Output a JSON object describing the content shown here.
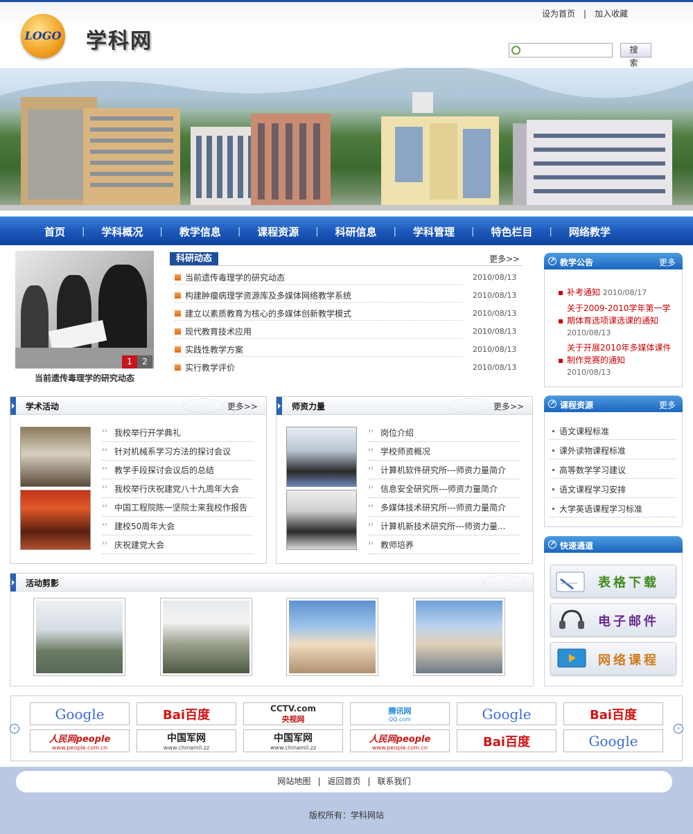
{
  "header": {
    "logo_text": "LOGO",
    "site_title": "学科网",
    "links": [
      "设为首页",
      "加入收藏"
    ],
    "link_sep": "|",
    "search_placeholder": "",
    "search_button": "搜 索"
  },
  "nav": {
    "items": [
      "首页",
      "学科概况",
      "教学信息",
      "课程资源",
      "科研信息",
      "学科管理",
      "特色栏目",
      "网络教学"
    ],
    "sep": "|"
  },
  "slideshow": {
    "caption": "当前遗传毒理学的研究动态",
    "pages": [
      "1",
      "2"
    ]
  },
  "research": {
    "title": "科研动态",
    "more": "更多>>",
    "items": [
      {
        "title": "当前遗传毒理学的研究动态",
        "date": "2010/08/13"
      },
      {
        "title": "构建肿瘤病理学资源库及多媒体网络教学系统",
        "date": "2010/08/13"
      },
      {
        "title": "建立以素质教育为核心的多媒体创新教学模式",
        "date": "2010/08/13"
      },
      {
        "title": "现代教育技术应用",
        "date": "2010/08/13"
      },
      {
        "title": "实践性教学方案",
        "date": "2010/08/13"
      },
      {
        "title": "实行教学评价",
        "date": "2010/08/13"
      }
    ]
  },
  "notice": {
    "title": "教学公告",
    "more": "更多",
    "items": [
      {
        "lines": [
          "补考通知"
        ],
        "date": "2010/08/17"
      },
      {
        "lines": [
          "关于2009-2010学年第一学",
          "期体育选项课选课的通知"
        ],
        "date": "2010/08/13"
      },
      {
        "lines": [
          "关于开展2010年多媒体课件",
          "制作竞赛的通知"
        ],
        "date": "2010/08/13"
      }
    ]
  },
  "academic": {
    "title": "学术活动",
    "more": "更多>>",
    "items": [
      "我校举行开学典礼",
      "针对机械系学习方法的探讨会议",
      "教学手段探讨会议后的总结",
      "我校举行庆祝建党八十九周年大会",
      "中国工程院陈一坚院士来我校作报告",
      "建校50周年大会",
      "庆祝建党大会"
    ]
  },
  "faculty": {
    "title": "师资力量",
    "more": "更多>>",
    "items": [
      "岗位介绍",
      "学校师资概况",
      "计算机软件研究所---师资力量简介",
      "信息安全研究所---师资力量简介",
      "多媒体技术研究所---师资力量简介",
      "计算机新技术研究所---师资力量...",
      "教师培养"
    ]
  },
  "course": {
    "title": "课程资源",
    "more": "更多",
    "items": [
      "语文课程标准",
      "课外读物课程标准",
      "高等数学学习建议",
      "语文课程学习安排",
      "大学英语课程学习标准"
    ]
  },
  "quick": {
    "title": "快速通道",
    "items": [
      {
        "label": "表格下载",
        "color": "#3e8a1c"
      },
      {
        "label": "电子邮件",
        "color": "#6a2a8e"
      },
      {
        "label": "网络课程",
        "color": "#d2791a"
      }
    ]
  },
  "gallery": {
    "title": "活动剪影"
  },
  "links": {
    "row1": [
      {
        "name": "Google",
        "sub": "",
        "kind": "google"
      },
      {
        "name": "Bai百度",
        "sub": "",
        "kind": "baidu"
      },
      {
        "name": "CCTV.com",
        "sub": "央视网",
        "kind": "cctv"
      },
      {
        "name": "腾讯网",
        "sub": "QQ.com",
        "kind": "qq"
      },
      {
        "name": "Google",
        "sub": "",
        "kind": "google"
      },
      {
        "name": "Bai百度",
        "sub": "",
        "kind": "baidu"
      }
    ],
    "row2": [
      {
        "name": "人民网people",
        "sub": "www.people.com.cn",
        "kind": "people"
      },
      {
        "name": "中国军网",
        "sub": "www.chinamil.zz",
        "kind": "mil"
      },
      {
        "name": "中国军网",
        "sub": "www.chinamil.zz",
        "kind": "mil"
      },
      {
        "name": "人民网people",
        "sub": "www.people.com.cn",
        "kind": "people"
      },
      {
        "name": "Bai百度",
        "sub": "",
        "kind": "baidu"
      },
      {
        "name": "Google",
        "sub": "",
        "kind": "google"
      }
    ]
  },
  "footer": {
    "links": [
      "网站地图",
      "返回首页",
      "联系我们"
    ],
    "sep": "|",
    "copyright": "版权所有：学科网站"
  }
}
